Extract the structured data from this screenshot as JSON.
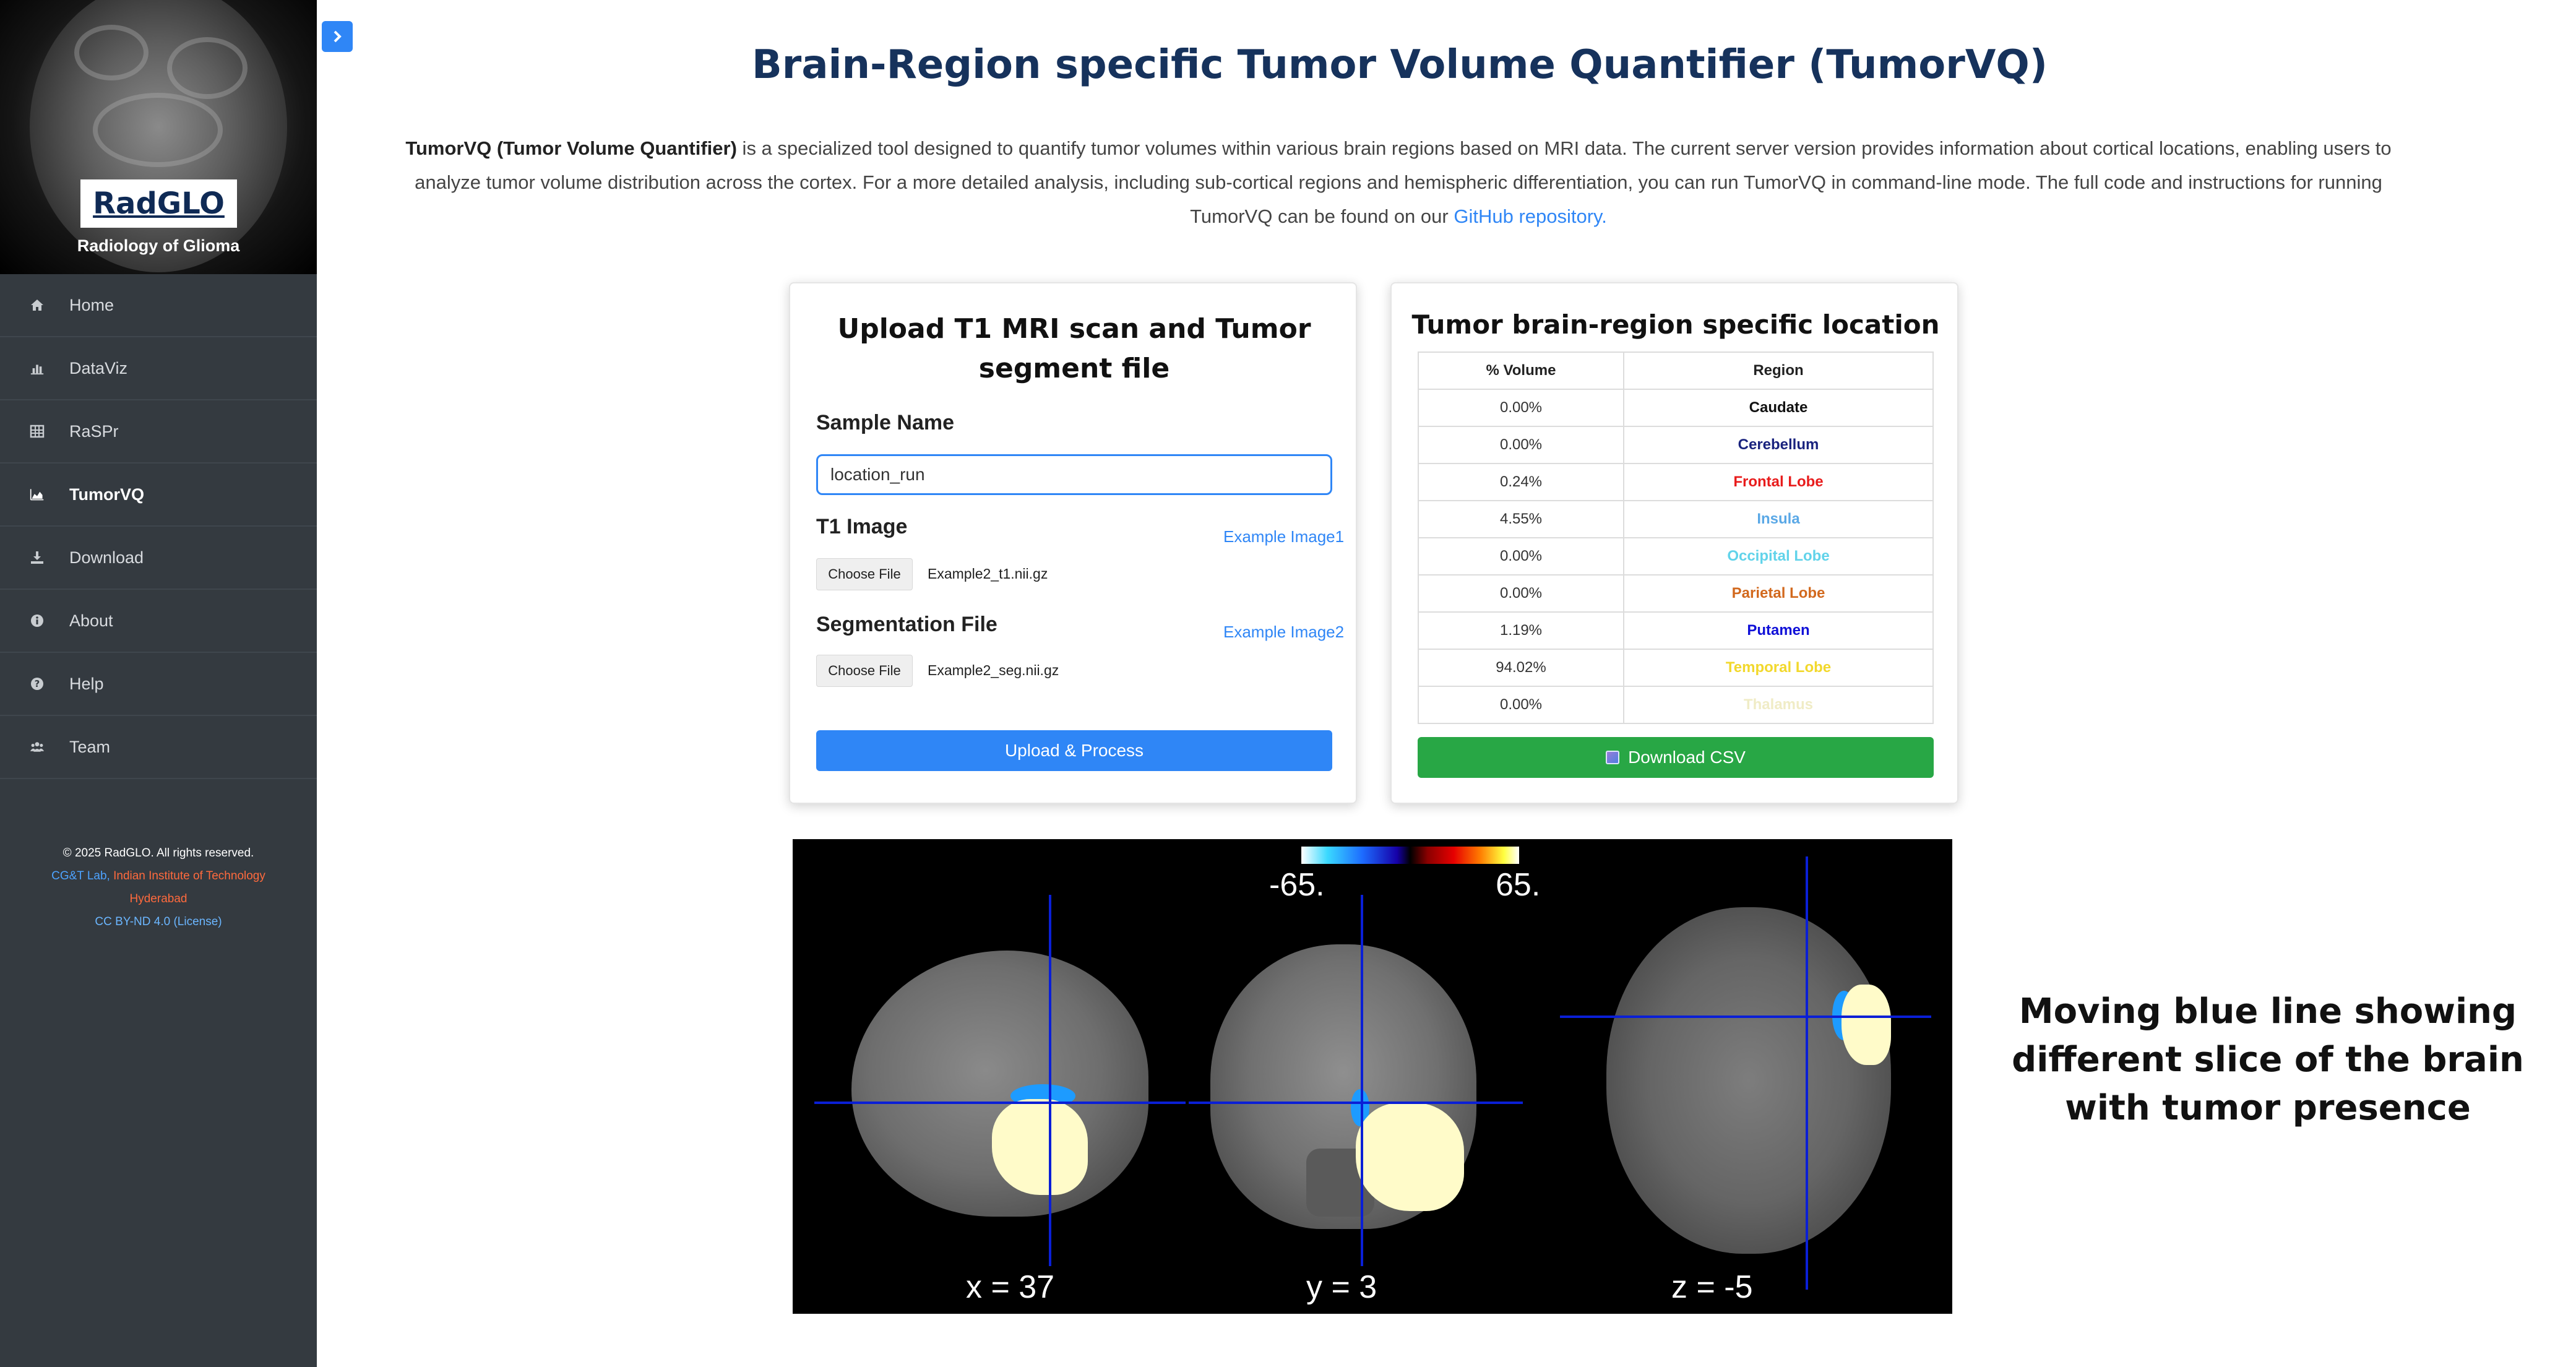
{
  "sidebar": {
    "brand": "RadGLO",
    "brand_subtitle": "Radiology of Glioma",
    "items": [
      {
        "label": "Home",
        "icon": "home-icon"
      },
      {
        "label": "DataViz",
        "icon": "bar-chart-icon"
      },
      {
        "label": "RaSPr",
        "icon": "grid-icon"
      },
      {
        "label": "TumorVQ",
        "icon": "area-chart-icon"
      },
      {
        "label": "Download",
        "icon": "download-icon"
      },
      {
        "label": "About",
        "icon": "info-icon"
      },
      {
        "label": "Help",
        "icon": "question-icon"
      },
      {
        "label": "Team",
        "icon": "users-icon"
      }
    ],
    "active": "TumorVQ",
    "footer": {
      "copyright": "© 2025 RadGLO. All rights reserved.",
      "lab": "CG&T Lab,",
      "institute_1": "Indian Institute of Technology",
      "institute_2": "Hyderabad",
      "license": "CC BY-ND 4.0 (License)"
    }
  },
  "header": {
    "title": "Brain-Region specific Tumor Volume Quantifier (TumorVQ)",
    "intro_bold": "TumorVQ (Tumor Volume Quantifier)",
    "intro_text": " is a specialized tool designed to quantify tumor volumes within various brain regions based on MRI data. The current server version provides information about cortical locations, enabling users to analyze tumor volume distribution across the cortex. For a more detailed analysis, including sub-cortical regions and hemispheric differentiation, you can run TumorVQ in command-line mode. The full code and instructions for running TumorVQ can be found on our ",
    "github_link": "GitHub repository."
  },
  "upload": {
    "title": "Upload T1 MRI scan and Tumor segment file",
    "sample_label": "Sample Name",
    "sample_value": "location_run",
    "t1_label": "T1 Image",
    "t1_example": "Example Image1",
    "t1_choose": "Choose File",
    "t1_file": "Example2_t1.nii.gz",
    "seg_label": "Segmentation File",
    "seg_example": "Example Image2",
    "seg_choose": "Choose File",
    "seg_file": "Example2_seg.nii.gz",
    "submit": "Upload & Process"
  },
  "regions": {
    "title": "Tumor brain-region specific location",
    "col_volume": "% Volume",
    "col_region": "Region",
    "rows": [
      {
        "volume": "0.00%",
        "region": "Caudate",
        "color": "#111111"
      },
      {
        "volume": "0.00%",
        "region": "Cerebellum",
        "color": "#1a237e"
      },
      {
        "volume": "0.24%",
        "region": "Frontal Lobe",
        "color": "#e81c1c"
      },
      {
        "volume": "4.55%",
        "region": "Insula",
        "color": "#5aa8e6"
      },
      {
        "volume": "0.00%",
        "region": "Occipital Lobe",
        "color": "#61d3ea"
      },
      {
        "volume": "0.00%",
        "region": "Parietal Lobe",
        "color": "#d2691e"
      },
      {
        "volume": "1.19%",
        "region": "Putamen",
        "color": "#1010d8"
      },
      {
        "volume": "94.02%",
        "region": "Temporal Lobe",
        "color": "#f2d82c"
      },
      {
        "volume": "0.00%",
        "region": "Thalamus",
        "color": "#f0ecc6"
      }
    ],
    "download": "Download CSV"
  },
  "mri": {
    "colorbar_min": "-65.",
    "colorbar_max": "65.",
    "slices": [
      "x = 37",
      "y = 3",
      "z = -5"
    ]
  },
  "annotation": "Moving blue line showing different slice of the brain with tumor presence"
}
